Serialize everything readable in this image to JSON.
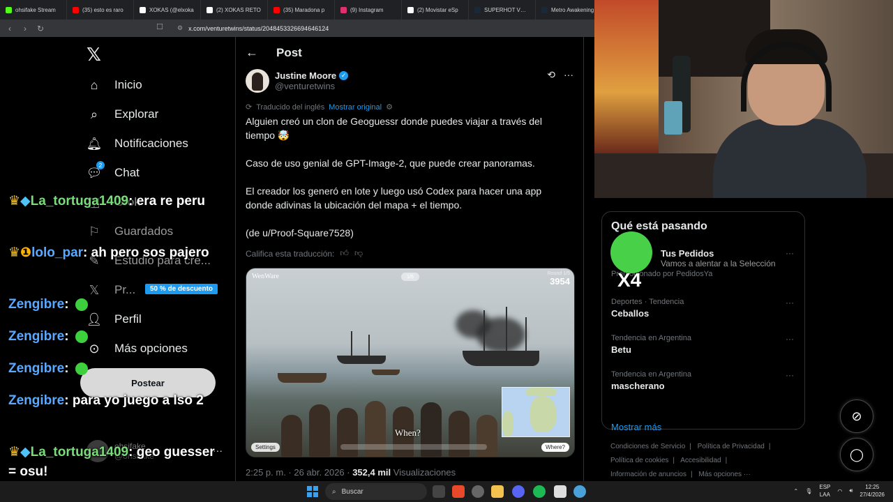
{
  "browser": {
    "tabs": [
      {
        "title": "ohsifake Stream",
        "color": "#53fc18"
      },
      {
        "title": "(35) esto es raro",
        "color": "#ff0000"
      },
      {
        "title": "XOKAS (@elxoka",
        "color": "#ffffff"
      },
      {
        "title": "(2) XOKAS RETO",
        "color": "#ffffff"
      },
      {
        "title": "(35) Maradona p",
        "color": "#ff0000"
      },
      {
        "title": "(9) Instagram",
        "color": "#e1306c"
      },
      {
        "title": "(2) Movistar eSp",
        "color": "#ffffff"
      },
      {
        "title": "SUPERHOT VR en",
        "color": "#1b2838"
      },
      {
        "title": "Metro Awakening",
        "color": "#1b2838"
      }
    ],
    "url": "x.com/venturetwins/status/2048453326694646124"
  },
  "nav": {
    "items": [
      {
        "label": "Inicio",
        "icon": "home-icon"
      },
      {
        "label": "Explorar",
        "icon": "search-icon"
      },
      {
        "label": "Notificaciones",
        "icon": "bell-icon"
      },
      {
        "label": "Chat",
        "icon": "chat-icon",
        "badge": "2"
      },
      {
        "label": "Grok",
        "icon": "grok-icon"
      },
      {
        "label": "Guardados",
        "icon": "bookmark-icon"
      },
      {
        "label": "Estudio para cre...",
        "icon": "studio-icon"
      },
      {
        "label": "Pr...",
        "icon": "x-premium-icon",
        "promo": "50 % de descuento"
      },
      {
        "label": "Perfil",
        "icon": "person-icon"
      },
      {
        "label": "Más opciones",
        "icon": "more-circle-icon"
      }
    ],
    "post_button": "Postear",
    "account": {
      "name": "ohsifake",
      "handle": "@ohsifake"
    }
  },
  "chat": [
    {
      "user": "La_tortuga1409",
      "text": "era re peru"
    },
    {
      "user": "lolo_par",
      "text": "ah pero sos pajero"
    },
    {
      "user": "Zengibre",
      "text": ""
    },
    {
      "user": "Zengibre",
      "text": ""
    },
    {
      "user": "Zengibre",
      "text": ""
    },
    {
      "user": "Zengibre",
      "text": "para yo juego a lso 2"
    },
    {
      "user": "La_tortuga1409",
      "text": "geo guesser = osu!"
    }
  ],
  "post": {
    "header": "Post",
    "author_name": "Justine Moore",
    "author_handle": "@venturetwins",
    "translated_label": "Traducido del inglés",
    "show_original": "Mostrar original",
    "paragraphs": [
      "Alguien creó un clon de Geoguessr donde puedes viajar a través del tiempo 🤯",
      "Caso de uso genial de GPT-Image-2, que puede crear panoramas.",
      "El creador los generó en lote y luego usó Codex para hacer una app donde adivinas la ubicación del mapa + el tiempo.",
      "(de u/Proof-Square7528)"
    ],
    "rate_translation": "Califica esta traducción:",
    "media": {
      "watermark": "WenWare",
      "score_label": "Round 1/5",
      "score": "3954",
      "when": "When?",
      "settings": "Settings",
      "where": "Where?"
    },
    "meta_time": "2:25 p. m. · 26 abr. 2026 · ",
    "meta_views": "352,4 mil",
    "meta_views_label": " Visualizaciones"
  },
  "trends": {
    "title": "Qué está pasando",
    "items": [
      {
        "category": "Promocionado por PedidosYa",
        "name": "Tus Pedidos",
        "desc": "Vamos a alentar a la Selección"
      },
      {
        "category": "Deportes · Tendencia",
        "name": "Ceballos"
      },
      {
        "category": "Tendencia en Argentina",
        "name": "Betu"
      },
      {
        "category": "Tendencia en Argentina",
        "name": "mascherano"
      }
    ],
    "show_more": "Mostrar más",
    "overlay": "X4"
  },
  "footer": [
    "Condiciones de Servicio",
    "Política de Privacidad",
    "Política de cookies",
    "Accesibilidad",
    "Información de anuncios",
    "Más opciones ···"
  ],
  "taskbar": {
    "search": "Buscar",
    "lang_top": "ESP",
    "lang_bottom": "LAA",
    "time": "12:25",
    "date": "27/4/2026"
  }
}
